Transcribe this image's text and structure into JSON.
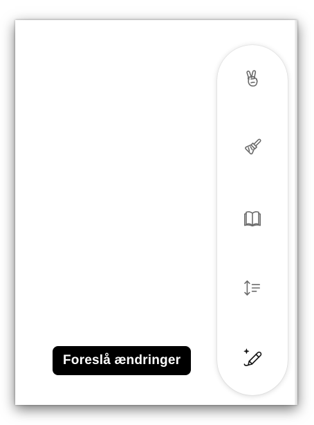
{
  "toolbar": {
    "tools": [
      {
        "icon": "hand-peace-icon",
        "label": ""
      },
      {
        "icon": "paintbrush-icon",
        "label": ""
      },
      {
        "icon": "book-open-icon",
        "label": ""
      },
      {
        "icon": "text-length-icon",
        "label": ""
      },
      {
        "icon": "sparkle-pencil-icon",
        "label": ""
      }
    ]
  },
  "tooltip": {
    "text": "Foreslå ændringer"
  },
  "colors": {
    "icon_default": "#6b6b6b",
    "icon_active": "#111111",
    "tooltip_bg": "#000000",
    "tooltip_text": "#ffffff"
  }
}
